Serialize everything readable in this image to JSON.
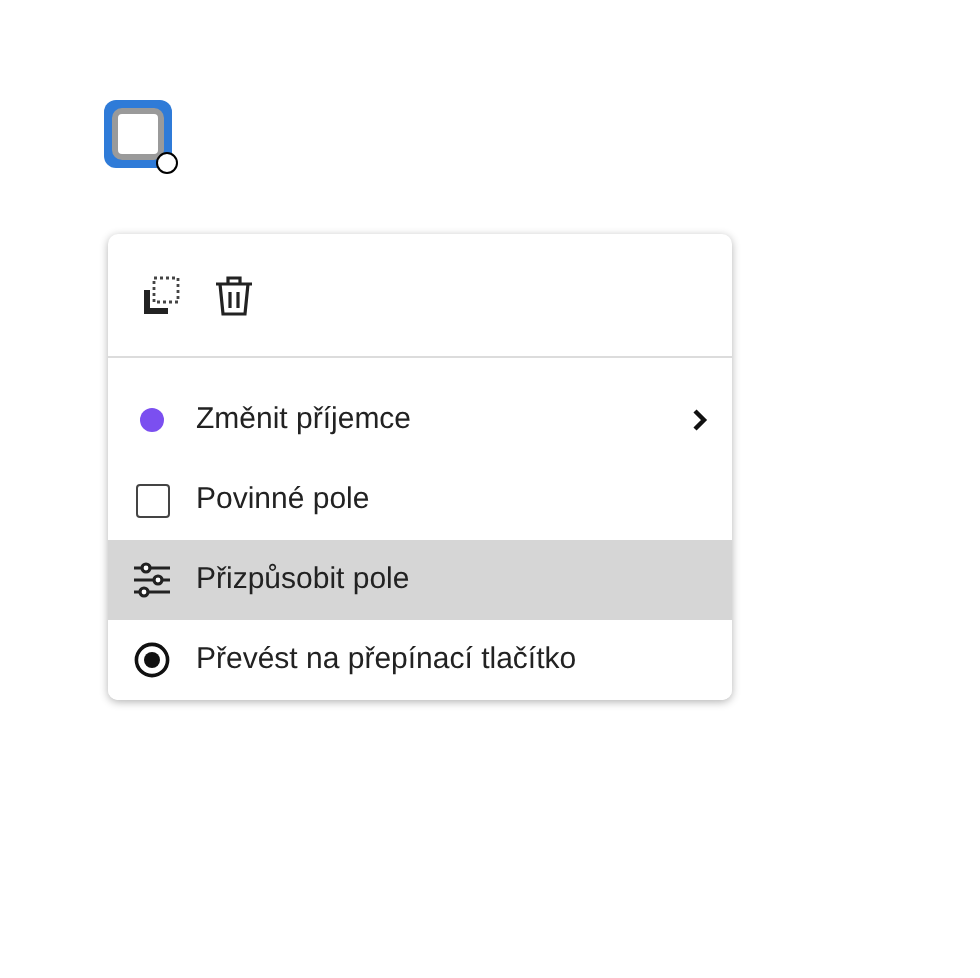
{
  "field": {
    "selected": true
  },
  "menu": {
    "items": [
      {
        "kind": "submenu",
        "label": "Změnit příjemce",
        "color": "#7b4ff0",
        "selected": false
      },
      {
        "kind": "checkbox",
        "label": "Povinné pole",
        "checked": false,
        "selected": false
      },
      {
        "kind": "adjust",
        "label": "Přizpůsobit pole",
        "selected": true
      },
      {
        "kind": "radio",
        "label": "Převést na přepínací tlačítko",
        "selected": false
      }
    ]
  }
}
